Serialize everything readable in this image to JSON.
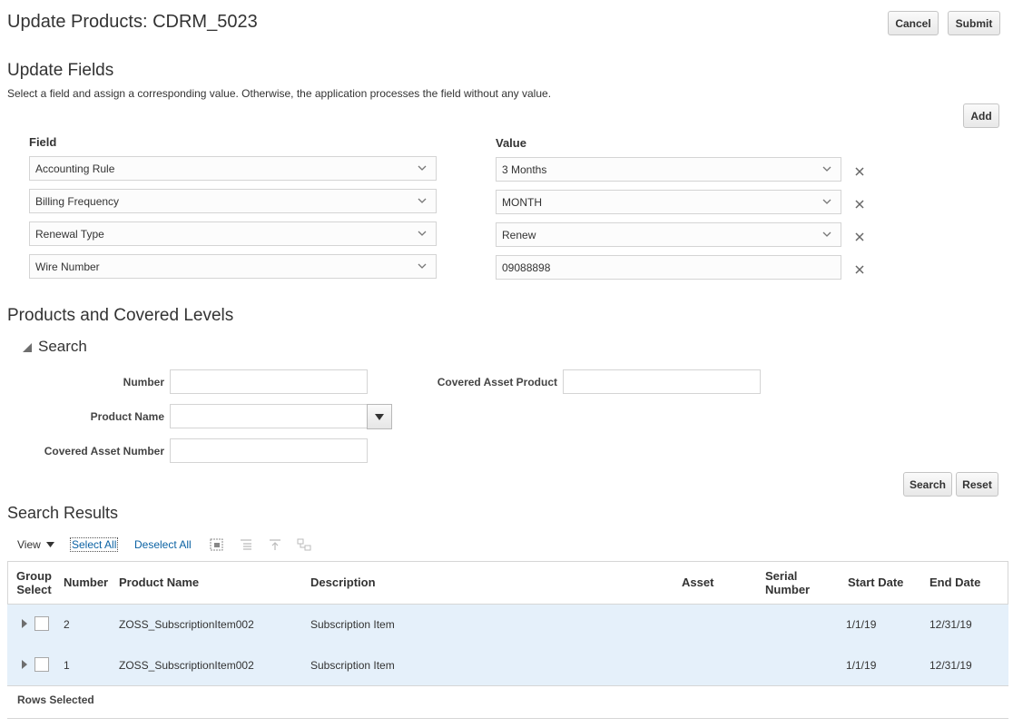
{
  "page": {
    "title": "Update Products: CDRM_5023"
  },
  "actions": {
    "cancel_label": "Cancel",
    "submit_label": "Submit"
  },
  "update_fields": {
    "heading": "Update Fields",
    "description": "Select a field and assign a corresponding value. Otherwise, the application processes the field without any value.",
    "add_label": "Add",
    "field_col_label": "Field",
    "value_col_label": "Value",
    "rows": [
      {
        "field": "Accounting Rule",
        "value": "3 Months"
      },
      {
        "field": "Billing Frequency",
        "value": "MONTH"
      },
      {
        "field": "Renewal Type",
        "value": "Renew"
      },
      {
        "field": "Wire Number",
        "value": "09088898"
      }
    ]
  },
  "products": {
    "heading": "Products and Covered Levels",
    "search": {
      "title": "Search",
      "number_label": "Number",
      "number_value": "",
      "product_name_label": "Product Name",
      "product_name_value": "",
      "covered_asset_number_label": "Covered Asset Number",
      "covered_asset_number_value": "",
      "covered_asset_product_label": "Covered Asset Product",
      "covered_asset_product_value": "",
      "search_label": "Search",
      "reset_label": "Reset"
    }
  },
  "results": {
    "heading": "Search Results",
    "toolbar": {
      "view_label": "View",
      "select_all_label": "Select All",
      "deselect_all_label": "Deselect All",
      "icons": [
        "detach-icon",
        "expand-all-icon",
        "collapse-all-icon",
        "hierarchy-icon"
      ]
    },
    "columns": {
      "group_select_1": "Group",
      "group_select_2": "Select",
      "number": "Number",
      "product_name": "Product Name",
      "description": "Description",
      "asset": "Asset",
      "serial_1": "Serial",
      "serial_2": "Number",
      "start_date": "Start Date",
      "end_date": "End Date"
    },
    "rows": [
      {
        "number": "2",
        "product_name": "ZOSS_SubscriptionItem002",
        "description": "Subscription Item",
        "asset": "",
        "serial": "",
        "start_date": "1/1/19",
        "end_date": "12/31/19"
      },
      {
        "number": "1",
        "product_name": "ZOSS_SubscriptionItem002",
        "description": "Subscription Item",
        "asset": "",
        "serial": "",
        "start_date": "1/1/19",
        "end_date": "12/31/19"
      }
    ],
    "footer_label": "Rows Selected"
  },
  "colors": {
    "row_highlight": "#e5f0fa",
    "link": "#0b62a3",
    "border": "#d4d4d4"
  }
}
